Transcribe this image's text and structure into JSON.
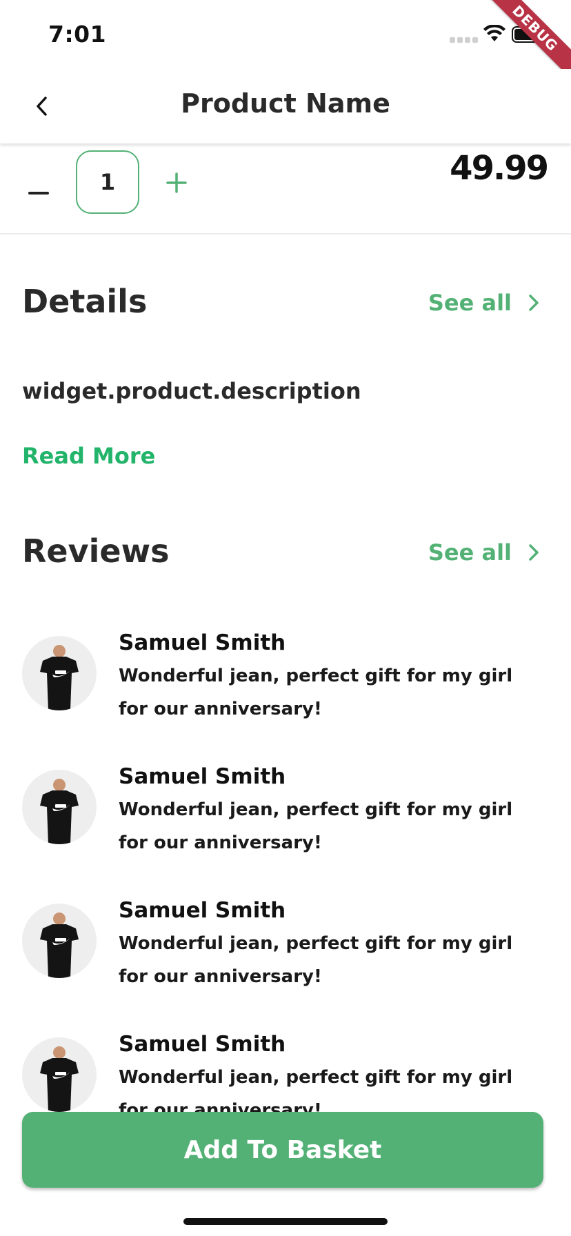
{
  "status_bar": {
    "time": "7:01",
    "debug_label": "DEBUG"
  },
  "app_bar": {
    "title": "Product Name"
  },
  "quantity": {
    "value": "1",
    "minus_symbol": "−",
    "plus_symbol": "+"
  },
  "price": "49.99",
  "details": {
    "title": "Details",
    "see_all": "See all",
    "description": "widget.product.description",
    "read_more": "Read More"
  },
  "reviews": {
    "title": "Reviews",
    "see_all": "See all",
    "items": [
      {
        "name": "Samuel Smith",
        "text": "Wonderful jean, perfect gift for my girl for our anniversary!"
      },
      {
        "name": "Samuel Smith",
        "text": "Wonderful jean, perfect gift for my girl for our anniversary!"
      },
      {
        "name": "Samuel Smith",
        "text": "Wonderful jean, perfect gift for my girl for our anniversary!"
      },
      {
        "name": "Samuel Smith",
        "text": "Wonderful jean, perfect gift for my girl for our anniversary!"
      }
    ]
  },
  "cta": {
    "label": "Add To Basket"
  },
  "colors": {
    "accent": "#53b175",
    "read_more": "#22b46a",
    "debug": "#b83345"
  },
  "icons": {
    "back": "chevron-left-icon",
    "see_all": "chevron-right-icon",
    "avatar": "tshirt-photo",
    "wifi": "wifi-icon",
    "battery": "battery-icon"
  }
}
